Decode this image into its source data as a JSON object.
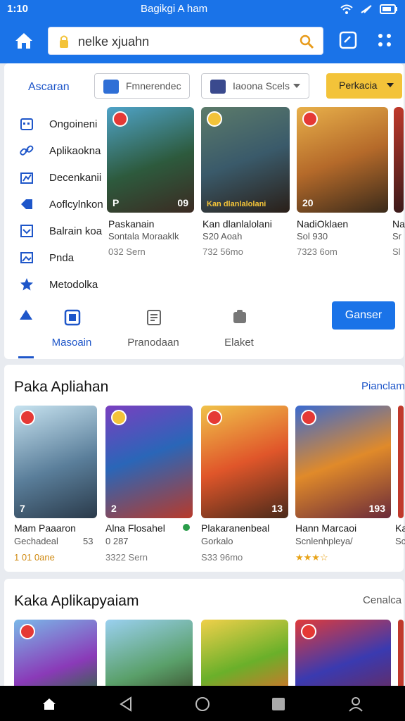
{
  "status_bar": {
    "time": "1:10",
    "center": "Bagikgi A ham",
    "icons": [
      "wifi-icon",
      "no-signal-icon",
      "battery-icon"
    ]
  },
  "toolbar": {
    "search_value": "nelke xjuahn",
    "icons": [
      "home-icon",
      "lock-icon",
      "search-icon",
      "square-icon",
      "grid-icon"
    ]
  },
  "filters": {
    "label": "Ascaran",
    "select1": "Fmnerendec",
    "select2": "Iaoona Scels",
    "button": "Perkacia"
  },
  "sidebar": {
    "items": [
      {
        "label": "Ongoineni",
        "icon": "calendar-icon"
      },
      {
        "label": "Aplikaokna",
        "icon": "link-icon"
      },
      {
        "label": "Decenkanii",
        "icon": "chart-icon"
      },
      {
        "label": "Aoflcylnkon",
        "icon": "tag-icon"
      },
      {
        "label": "Balrain koa",
        "icon": "inbox-icon"
      },
      {
        "label": "Pnda",
        "icon": "image-icon"
      },
      {
        "label": "Metodolka",
        "icon": "star-icon"
      }
    ]
  },
  "featured": [
    {
      "title": "Paskanain",
      "sub": "Sontala Moraaklk",
      "size": "032 Sern",
      "badge": "P",
      "count": "09"
    },
    {
      "title": "Kan dlanlalolani",
      "sub": "S20 Aoah",
      "size": "732 56mo",
      "badge": "Kan dlanlalolani",
      "count": ""
    },
    {
      "title": "NadiOklaen",
      "sub": "Sol 930",
      "size": "7323 6om",
      "badge": "20",
      "count": ""
    },
    {
      "title": "Na",
      "sub": "Sr",
      "size": "Sl",
      "badge": "",
      "count": ""
    }
  ],
  "category_tabs": [
    {
      "label": "Masoain",
      "icon": "app-icon"
    },
    {
      "label": "Pranodaan",
      "icon": "book-icon"
    },
    {
      "label": "Elaket",
      "icon": "chat-icon"
    }
  ],
  "go_button": "Ganser",
  "section1": {
    "title": "Paka Apliahan",
    "link": "Pianclam",
    "games": [
      {
        "title": "Mam Paaaron",
        "sub": "Gechadeal",
        "sub_right": "53",
        "foot": "1 01 0ane",
        "badge": "7",
        "count": ""
      },
      {
        "title": "Alna Flosahel",
        "sub": "0 287",
        "sub_right": "",
        "foot": "3322 Sern",
        "badge": "2",
        "count": ""
      },
      {
        "title": "Plakaranenbeal",
        "sub": "Gorkalo",
        "sub_right": "",
        "foot": "S33 96mo",
        "badge": "",
        "count": "13"
      },
      {
        "title": "Hann Marcaoi",
        "sub": "Scnlenhpleya/",
        "sub_right": "",
        "foot": "★★★☆",
        "badge": "",
        "count": "193"
      },
      {
        "title": "Ka",
        "sub": "Sc",
        "sub_right": "",
        "foot": "",
        "badge": "",
        "count": ""
      }
    ]
  },
  "section2": {
    "title": "Kaka Aplikapyaiam",
    "link": "Cenalca"
  },
  "nav": [
    "home-nav-icon",
    "back-nav-icon",
    "circle-nav-icon",
    "square-nav-icon",
    "person-nav-icon"
  ],
  "colors": {
    "primary": "#1a73e8",
    "accent": "#f3c339",
    "link": "#1e56c9"
  }
}
